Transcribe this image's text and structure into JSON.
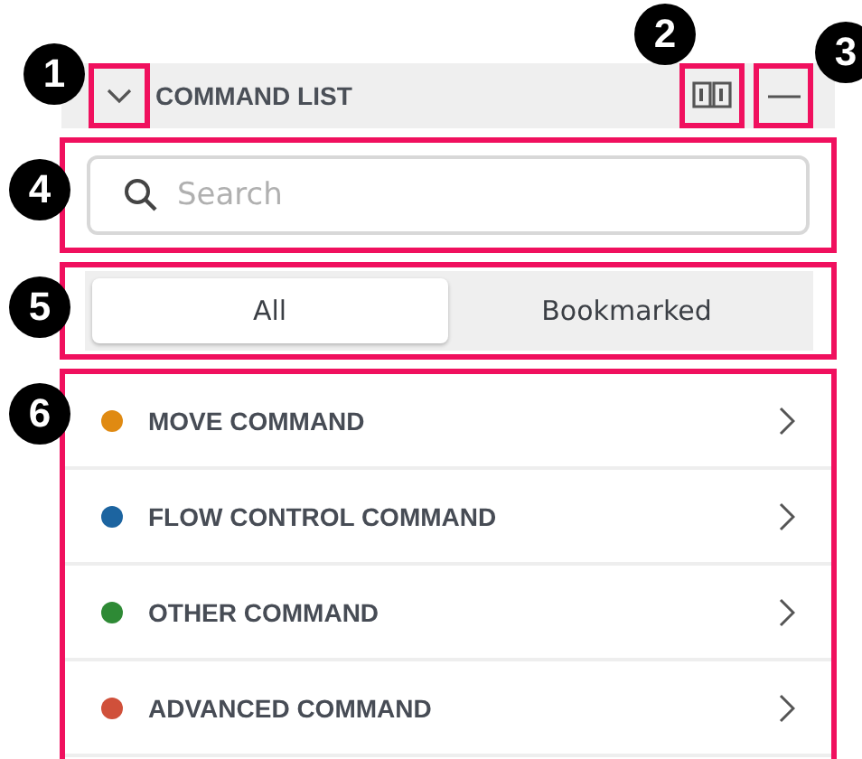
{
  "panel": {
    "title": "COMMAND LIST"
  },
  "search": {
    "placeholder": "Search"
  },
  "tabs": [
    {
      "label": "All",
      "selected": true
    },
    {
      "label": "Bookmarked",
      "selected": false
    }
  ],
  "commands": [
    {
      "name": "MOVE COMMAND",
      "color": "#e08a12"
    },
    {
      "name": "FLOW CONTROL COMMAND",
      "color": "#1c64a0"
    },
    {
      "name": "OTHER COMMAND",
      "color": "#2e8a35"
    },
    {
      "name": "ADVANCED COMMAND",
      "color": "#d0503a"
    }
  ],
  "callouts": [
    "1",
    "2",
    "3",
    "4",
    "5",
    "6"
  ]
}
